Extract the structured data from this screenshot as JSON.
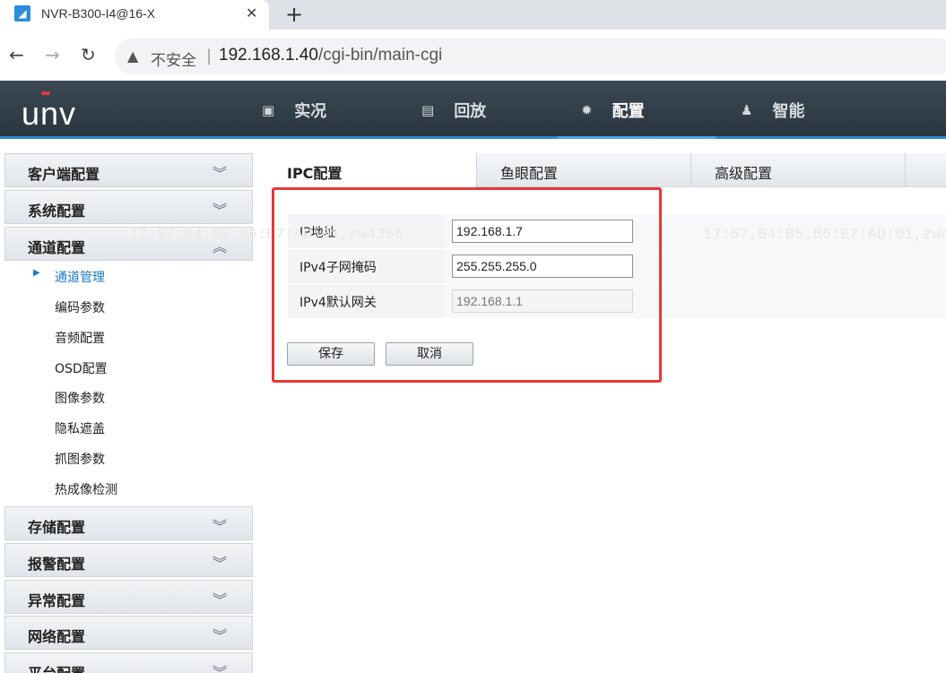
{
  "browser": {
    "tab_title": "NVR-B300-I4@16-X",
    "tab_close": "✕",
    "new_tab": "+",
    "back": "←",
    "forward": "→",
    "reload": "↻",
    "security_text": "不安全",
    "url_host": "192.168.1.40",
    "url_path": "/cgi-bin/main-cgi"
  },
  "header": {
    "logo": "unv",
    "nav": [
      {
        "label": "实况",
        "icon": "monitor-icon"
      },
      {
        "label": "回放",
        "icon": "film-icon"
      },
      {
        "label": "配置",
        "icon": "gear-icon",
        "active": true
      },
      {
        "label": "智能",
        "icon": "user-search-icon"
      }
    ]
  },
  "sidebar": {
    "sections": [
      {
        "label": "客户端配置",
        "expanded": false
      },
      {
        "label": "系统配置",
        "expanded": false
      },
      {
        "label": "通道配置",
        "expanded": true
      },
      {
        "label": "存储配置",
        "expanded": false
      },
      {
        "label": "报警配置",
        "expanded": false
      },
      {
        "label": "异常配置",
        "expanded": false
      },
      {
        "label": "网络配置",
        "expanded": false
      },
      {
        "label": "平台配置",
        "expanded": false
      }
    ],
    "channel_items": [
      {
        "label": "通道管理",
        "active": true
      },
      {
        "label": "编码参数"
      },
      {
        "label": "音频配置"
      },
      {
        "label": "OSD配置"
      },
      {
        "label": "图像参数"
      },
      {
        "label": "隐私遮盖"
      },
      {
        "label": "抓图参数"
      },
      {
        "label": "热成像检测"
      }
    ]
  },
  "main": {
    "tabs": [
      {
        "label": "IPC配置",
        "active": true
      },
      {
        "label": "鱼眼配置"
      },
      {
        "label": "高级配置"
      }
    ],
    "watermark": "17:57,B4:B5:B6:E7:AD:01,zw4356",
    "form": {
      "ip_label": "IP地址",
      "ip_value": "192.168.1.7",
      "mask_label": "IPv4子网掩码",
      "mask_value": "255.255.255.0",
      "gateway_label": "IPv4默认网关",
      "gateway_value": "192.168.1.1"
    },
    "save_label": "保存",
    "cancel_label": "取消"
  },
  "colors": {
    "header_bg": "#2f3b45",
    "accent": "#2e87c8",
    "highlight_box": "#e53935",
    "active_link": "#1a79c7"
  }
}
